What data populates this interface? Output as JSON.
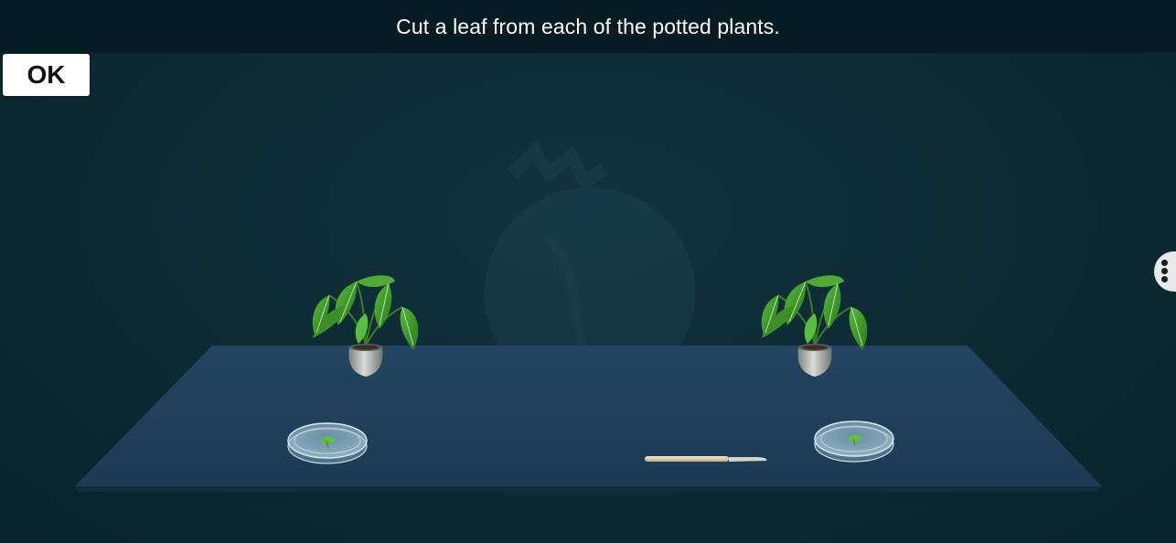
{
  "header": {
    "instruction": "Cut a leaf from each of the potted plants."
  },
  "controls": {
    "ok_label": "OK"
  },
  "scene": {
    "objects": [
      "potted-plant-left",
      "potted-plant-right",
      "petri-dish-left",
      "petri-dish-right",
      "scalpel"
    ]
  },
  "colors": {
    "background": "#0e2b34",
    "topbar": "#061c22",
    "table": "#1f3f5a",
    "leaf": "#3f9a2c",
    "ok_button": "#ffffff"
  },
  "icons": {
    "menu": "more-vertical-icon",
    "watermark": "plant-cell-watermark-icon"
  }
}
